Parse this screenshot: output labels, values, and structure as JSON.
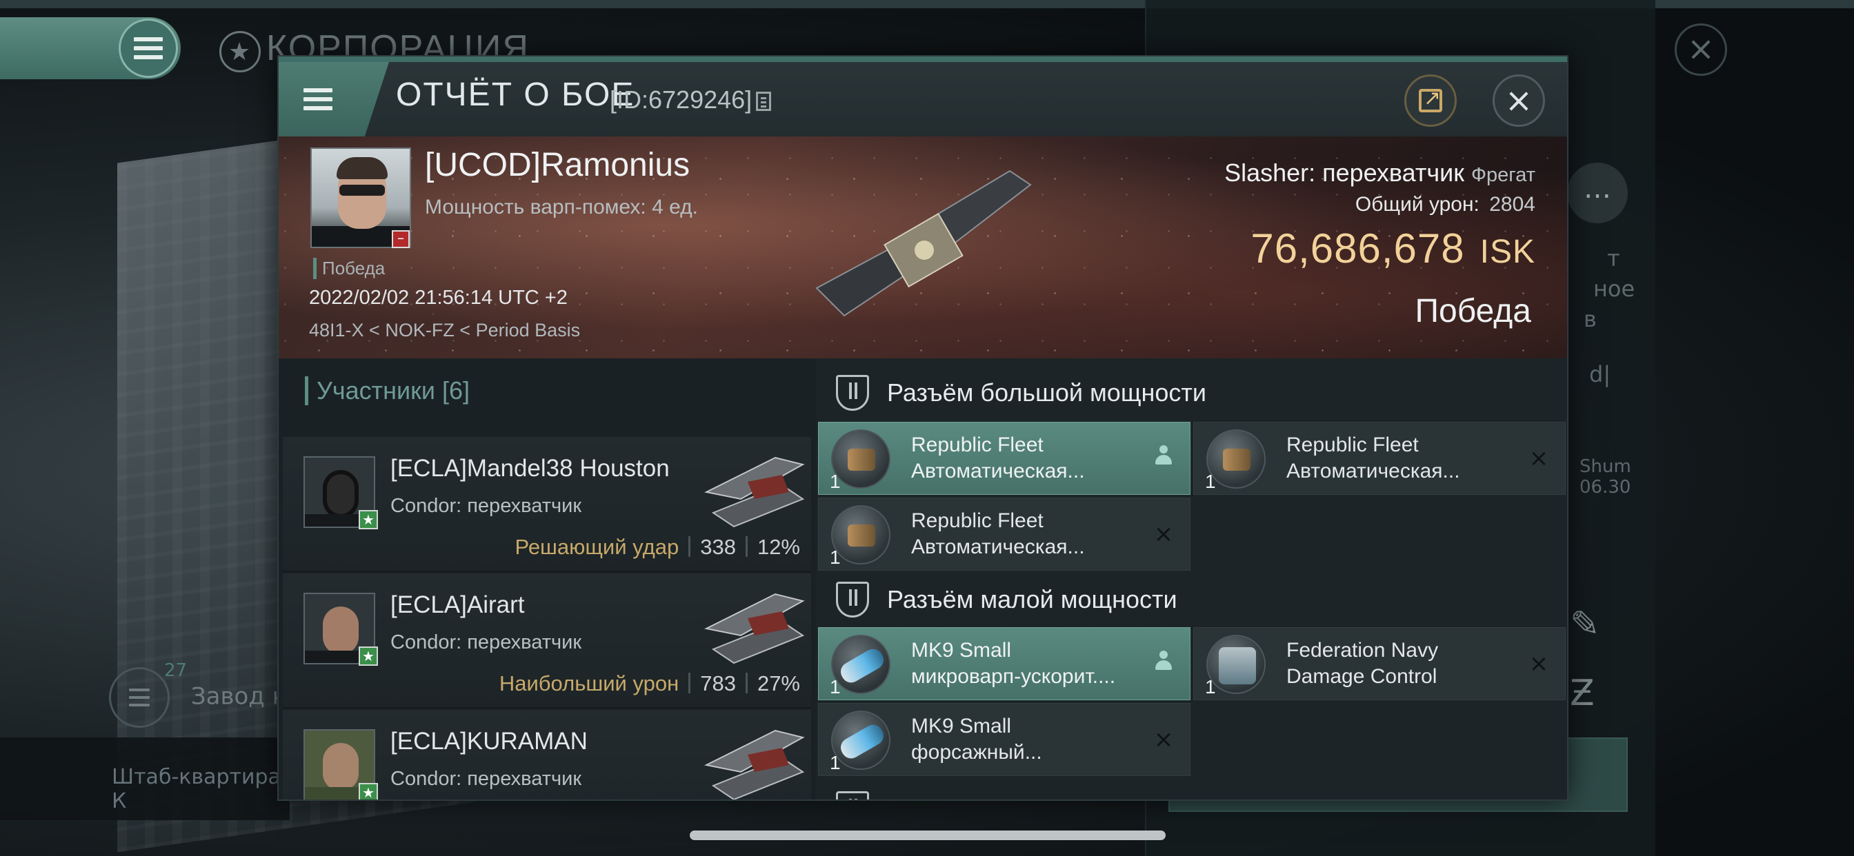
{
  "background": {
    "corp_title": "КОРПОРАЦИЯ",
    "zavod_label": "Завод к",
    "zavod_count": "27",
    "hq_label": "Штаб-квартира К",
    "side_texts": [
      "т",
      "ное",
      "в",
      "d|",
      "Shum",
      "06.30"
    ]
  },
  "report": {
    "title": "ОТЧЁТ О БОЕ",
    "id": "[ID:6729246]"
  },
  "victim": {
    "name": "[UCOD]Ramonius",
    "warp_scramble": "Мощность варп-помех: 4 ед.",
    "tag": "Победа",
    "datetime": "2022/02/02 21:56:14 UTC +2",
    "location": "48I1-X < NOK-FZ < Period Basis",
    "ship_name": "Slasher: перехватчик",
    "ship_class": "Фрегат",
    "total_damage_label": "Общий урон:",
    "total_damage": "2804",
    "isk_value": "76,686,678",
    "isk_unit": "ISK",
    "result": "Победа"
  },
  "participants": {
    "label": "Участники [6]",
    "items": [
      {
        "name": "[ECLA]Mandel38 Houston",
        "ship": "Condor: перехватчик",
        "tag": "Решающий удар",
        "damage": "338",
        "percent": "12%"
      },
      {
        "name": "[ECLA]Airart",
        "ship": "Condor: перехватчик",
        "tag": "Наибольший урон",
        "damage": "783",
        "percent": "27%"
      },
      {
        "name": "[ECLA]KURAMAN",
        "ship": "Condor: перехватчик",
        "tag": "",
        "damage": "",
        "percent": ""
      }
    ]
  },
  "modules": {
    "high_slot_label": "Разъём большой мощности",
    "low_slot_label": "Разъём малой мощности",
    "high": [
      {
        "line1": "Republic Fleet",
        "line2": "Автоматическая...",
        "qty": "1",
        "status": "dropped"
      },
      {
        "line1": "Republic Fleet",
        "line2": "Автоматическая...",
        "qty": "1",
        "status": "destroyed"
      },
      {
        "line1": "Republic Fleet",
        "line2": "Автоматическая...",
        "qty": "1",
        "status": "destroyed"
      }
    ],
    "low": [
      {
        "line1": "MK9 Small",
        "line2": "микроварп-ускорит....",
        "qty": "1",
        "status": "dropped"
      },
      {
        "line1": "Federation Navy",
        "line2": "Damage Control",
        "qty": "1",
        "status": "destroyed"
      },
      {
        "line1": "MK9 Small",
        "line2": "форсажный...",
        "qty": "1",
        "status": "destroyed"
      }
    ]
  },
  "icons": {
    "menu": "hamburger-icon",
    "copy": "copy-icon",
    "share": "share-icon",
    "close": "close-icon",
    "destroyed": "×",
    "dropped": "person-icon"
  },
  "colors": {
    "accent_teal": "#5d8e83",
    "isk_gold": "#f2d29a",
    "tag_gold": "#c7a969"
  }
}
